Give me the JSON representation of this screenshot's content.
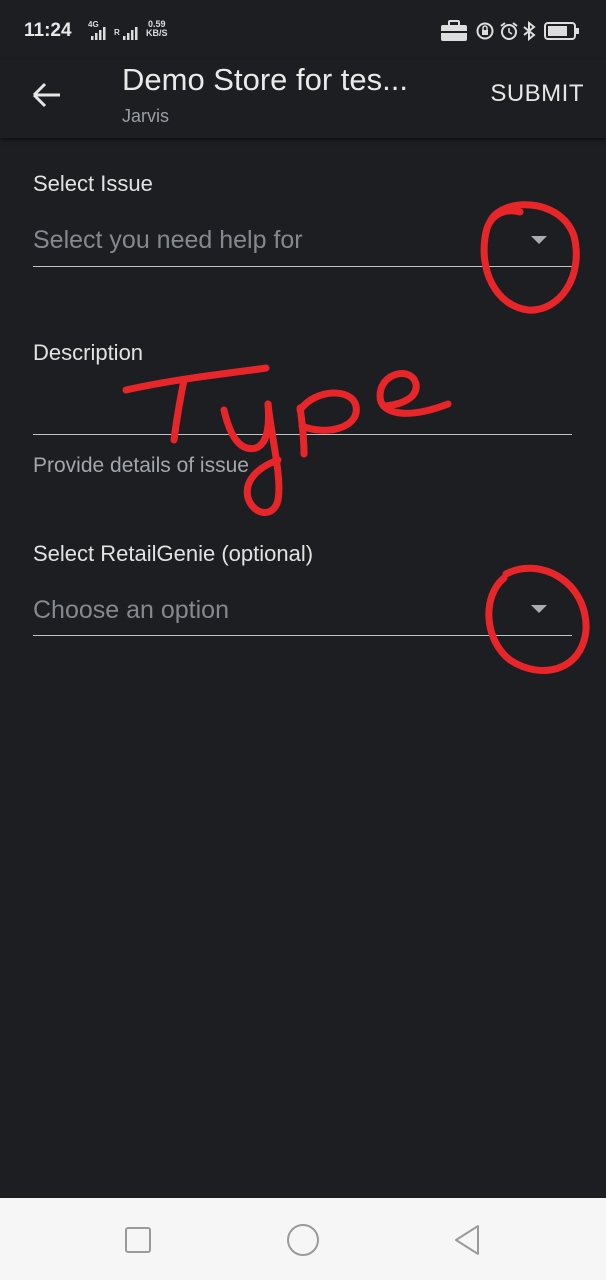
{
  "status_bar": {
    "time": "11:24",
    "network_type": "4G",
    "roaming": "R",
    "speed_value": "0.59",
    "speed_unit": "KB/S"
  },
  "app_bar": {
    "title": "Demo Store for tes...",
    "subtitle": "Jarvis",
    "submit_label": "SUBMIT",
    "back_icon": "arrow-left-icon"
  },
  "form": {
    "issue": {
      "label": "Select Issue",
      "placeholder": "Select you need help for"
    },
    "description": {
      "label": "Description",
      "value": "",
      "helper": "Provide details of issue"
    },
    "retail_genie": {
      "label": "Select RetailGenie (optional)",
      "placeholder": "Choose an option"
    }
  },
  "annotations": {
    "handwritten_text": "Type",
    "color": "#e8262a"
  },
  "nav_bar": {
    "icons": [
      "square-recents-icon",
      "circle-home-icon",
      "triangle-back-icon"
    ]
  },
  "colors": {
    "background": "#1c1e22",
    "placeholder": "#85888d",
    "nav_background": "#f6f6f6"
  }
}
